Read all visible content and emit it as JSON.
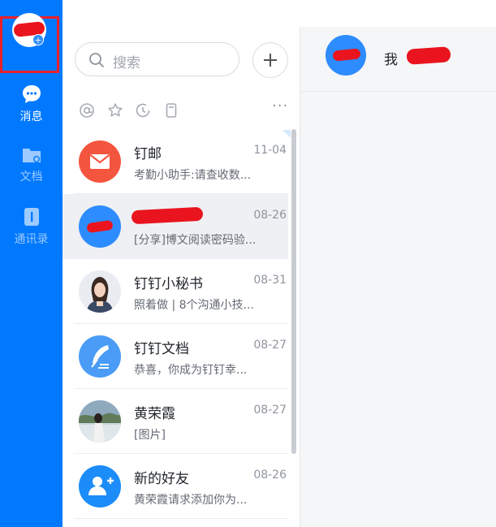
{
  "nav": {
    "items": [
      {
        "label": "消息",
        "icon": "chat-bubble-icon",
        "active": true
      },
      {
        "label": "文档",
        "icon": "folder-icon",
        "active": false
      },
      {
        "label": "通讯录",
        "icon": "contacts-book-icon",
        "active": false
      }
    ]
  },
  "search": {
    "placeholder": "搜索"
  },
  "filters": [
    "at-mention-icon",
    "star-icon",
    "clock-icon",
    "pin-icon"
  ],
  "filters_more": "···",
  "conversations": [
    {
      "name": "钉邮",
      "date": "11-04",
      "preview": "考勤小助手:请查收数...",
      "avatar": "mail-icon"
    },
    {
      "name": "",
      "date": "08-26",
      "preview": "[分享]博文阅读密码验...",
      "avatar": "redacted-avatar",
      "selected": true
    },
    {
      "name": "钉钉小秘书",
      "date": "08-31",
      "preview": "照着做 | 8个沟通小技...",
      "avatar": "photo-woman"
    },
    {
      "name": "钉钉文档",
      "date": "08-27",
      "preview": "恭喜，你成为钉钉幸...",
      "avatar": "quill-doc-icon"
    },
    {
      "name": "黄荣霞",
      "date": "08-27",
      "preview": "[图片]",
      "avatar": "photo-girl"
    },
    {
      "name": "新的好友",
      "date": "08-26",
      "preview": "黄荣霞请求添加你为...",
      "avatar": "add-friend-icon"
    }
  ],
  "chat_header": {
    "title": "我"
  },
  "colors": {
    "rail": "#0079ff",
    "accent": "#2d8cff",
    "redaction": "#e9141e",
    "mail": "#f4553e"
  }
}
